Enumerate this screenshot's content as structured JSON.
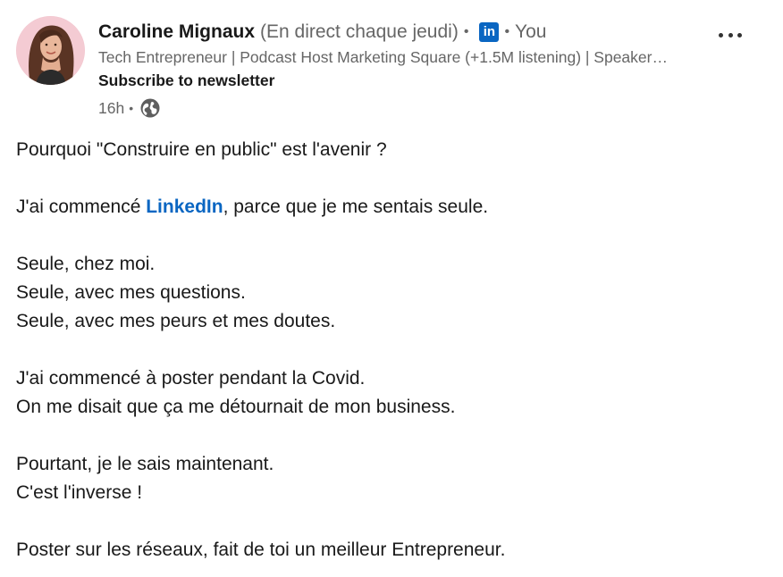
{
  "author": {
    "name": "Caroline Mignaux",
    "name_extra": "(En direct chaque jeudi)",
    "separator": "•",
    "badge": "in",
    "you_label": "You",
    "headline": "Tech Entrepreneur | Podcast Host Marketing Square (+1.5M listening) | Speaker…",
    "subscribe_label": "Subscribe to newsletter",
    "time": "16h",
    "visibility_icon": "globe-icon",
    "avatar_icon": "avatar-photo"
  },
  "menu": {
    "icon": "more-horizontal-icon"
  },
  "post": {
    "line1": "Pourquoi \"Construire en public\" est l'avenir ?",
    "line2_before": "J'ai commencé ",
    "line2_mention": "LinkedIn",
    "line2_after": ", parce que je me sentais seule.",
    "line3": "Seule, chez moi.",
    "line4": "Seule, avec mes questions.",
    "line5": "Seule, avec mes peurs et mes doutes.",
    "line6": "J'ai commencé à poster pendant la Covid.",
    "line7": "On me disait que ça me détournait de mon business.",
    "line8": "Pourtant, je le sais maintenant.",
    "line9": "C'est l'inverse !",
    "line10": "Poster sur les réseaux, fait de toi un meilleur Entrepreneur."
  },
  "colors": {
    "link": "#0a66c2",
    "secondary_text": "#666666",
    "primary_text": "#191919"
  }
}
